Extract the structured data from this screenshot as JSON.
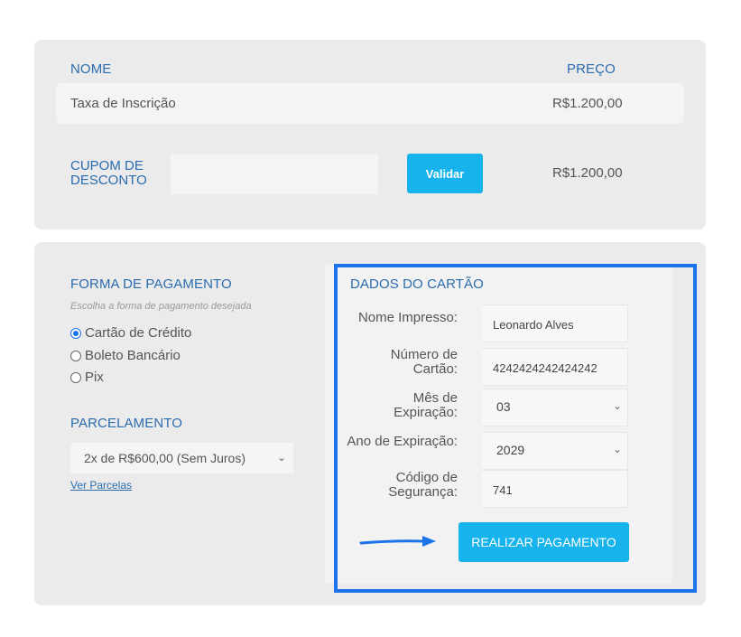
{
  "summary": {
    "col_nome": "NOME",
    "col_preco": "PREÇO",
    "item_name": "Taxa de Inscrição",
    "item_price": "R$1.200,00",
    "cupom_label": "CUPOM DE DESCONTO",
    "cupom_value": "",
    "validar_label": "Validar",
    "total_price": "R$1.200,00"
  },
  "payment": {
    "title": "FORMA DE PAGAMENTO",
    "subtitle": "Escolha a forma de pagamento desejada",
    "options": [
      {
        "label": "Cartão de Crédito",
        "checked": true
      },
      {
        "label": "Boleto Bancário",
        "checked": false
      },
      {
        "label": "Pix",
        "checked": false
      }
    ]
  },
  "installments": {
    "title": "PARCELAMENTO",
    "selected": "2x de R$600,00 (Sem Juros)",
    "link": "Ver Parcelas"
  },
  "card": {
    "title": "DADOS DO CARTÃO",
    "name_label": "Nome Impresso:",
    "name_value": "Leonardo Alves",
    "number_label": "Número de Cartão:",
    "number_value": "4242424242424242",
    "month_label": "Mês de Expiração:",
    "month_value": "03",
    "year_label": "Ano de Expiração:",
    "year_value": "2029",
    "cvv_label": "Código de Segurança:",
    "cvv_value": "741",
    "pay_label": "REALIZAR PAGAMENTO"
  },
  "colors": {
    "accent": "#16b3ec",
    "heading": "#2b6cb0",
    "highlight": "#1a73e8"
  }
}
